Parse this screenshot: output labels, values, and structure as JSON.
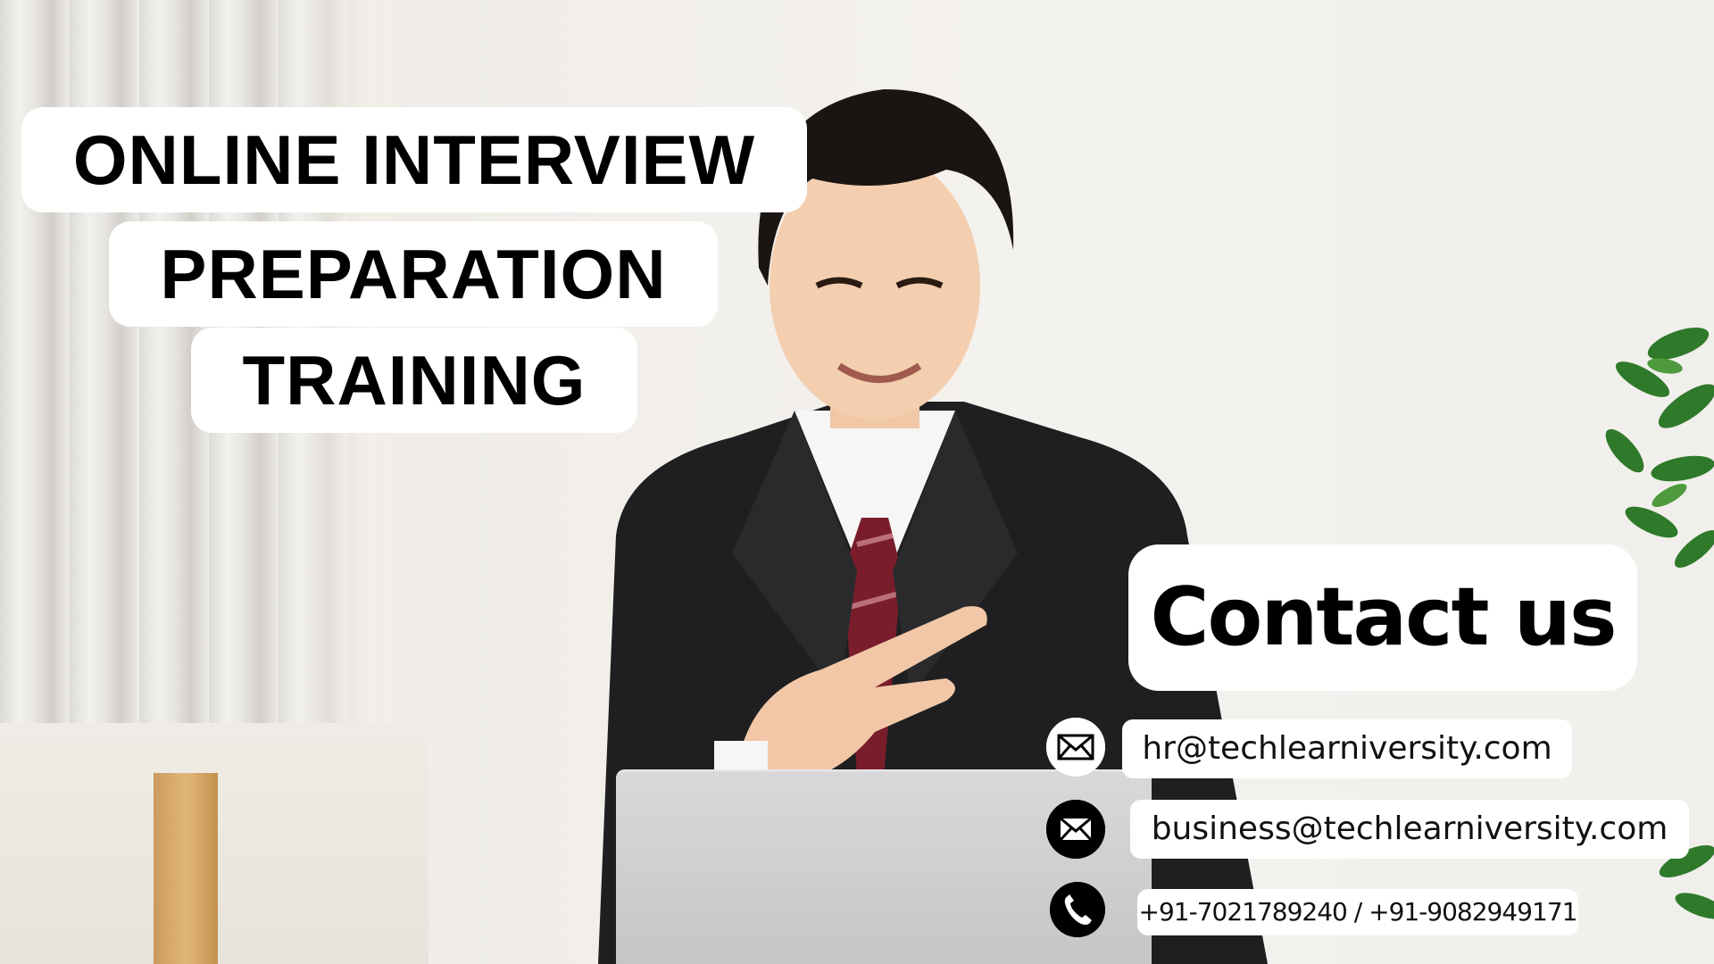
{
  "title": {
    "lines": [
      "ONLINE INTERVIEW",
      "PREPARATION",
      "TRAINING"
    ]
  },
  "contact": {
    "heading": "Contact us",
    "items": [
      {
        "icon": "envelope-icon",
        "text": "hr@techlearniversity.com"
      },
      {
        "icon": "envelope-icon",
        "text": "business@techlearniversity.com"
      },
      {
        "icon": "phone-icon",
        "text": "+91-7021789240 / +91-9082949171"
      }
    ]
  },
  "colors": {
    "text": "#000000",
    "panel": "#ffffff",
    "suit": "#1f1f21",
    "tie": "#7a1d2b",
    "plant": "#2f7a2a"
  }
}
